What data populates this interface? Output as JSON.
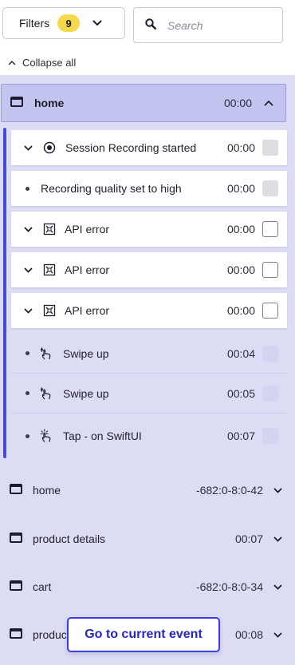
{
  "filters": {
    "label": "Filters",
    "count": "9"
  },
  "search": {
    "placeholder": "Search",
    "value": ""
  },
  "collapse_all": "Collapse all",
  "home_group": {
    "title": "home",
    "time": "00:00",
    "events": [
      {
        "label": "Session Recording started",
        "time": "00:00",
        "icon": "record-icon",
        "expandable": true
      },
      {
        "label": "Recording quality set to high",
        "time": "00:00",
        "icon": "bullet",
        "expandable": false
      },
      {
        "label": "API error",
        "time": "00:00",
        "icon": "api-error-icon",
        "expandable": true
      },
      {
        "label": "API error",
        "time": "00:00",
        "icon": "api-error-icon",
        "expandable": true
      },
      {
        "label": "API error",
        "time": "00:00",
        "icon": "api-error-icon",
        "expandable": true
      },
      {
        "label": "Swipe up",
        "time": "00:04",
        "icon": "swipe-icon",
        "expandable": false
      },
      {
        "label": "Swipe up",
        "time": "00:05",
        "icon": "swipe-icon",
        "expandable": false
      },
      {
        "label": "Tap - on SwiftUI",
        "time": "00:07",
        "icon": "tap-icon",
        "expandable": false
      }
    ]
  },
  "sections": [
    {
      "label": "home",
      "time": "-682:0-8:0-42"
    },
    {
      "label": "product details",
      "time": "00:07"
    },
    {
      "label": "cart",
      "time": "-682:0-8:0-34"
    },
    {
      "label": "product details",
      "time": "00:08"
    }
  ],
  "goto_button": "Go to current event",
  "colors": {
    "accent": "#3d3de0",
    "panel": "#dcdcf4",
    "header": "#c4c4f0",
    "badge": "#f5d94a"
  }
}
